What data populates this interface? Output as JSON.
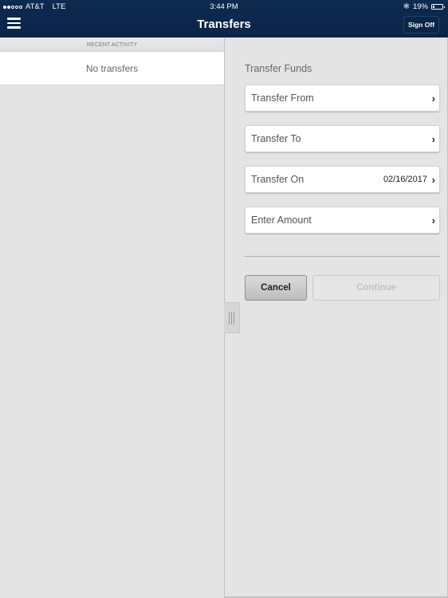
{
  "status_bar": {
    "carrier": "AT&T",
    "network": "LTE",
    "signal_bars_filled": 2,
    "signal_bars_total": 5,
    "time": "3:44 PM",
    "bluetooth_icon": "bluetooth-icon",
    "battery_percent": "19%",
    "battery_level": 0.19
  },
  "header": {
    "menu_icon": "hamburger-menu-icon",
    "title": "Transfers",
    "sign_off_label": "Sign Off"
  },
  "recent_activity": {
    "section_label": "RECENT ACTIVITY",
    "empty_message": "No transfers"
  },
  "transfer_form": {
    "title": "Transfer Funds",
    "fields": [
      {
        "label": "Transfer From",
        "value": ""
      },
      {
        "label": "Transfer To",
        "value": ""
      },
      {
        "label": "Transfer On",
        "value": "02/16/2017"
      },
      {
        "label": "Enter Amount",
        "value": ""
      }
    ],
    "chevron_icon": "chevron-right-icon",
    "cancel_label": "Cancel",
    "continue_label": "Continue",
    "continue_enabled": false
  },
  "colors": {
    "header_bg": "#0b2649",
    "panel_bg": "#e4e4e4",
    "field_bg": "#ffffff"
  }
}
